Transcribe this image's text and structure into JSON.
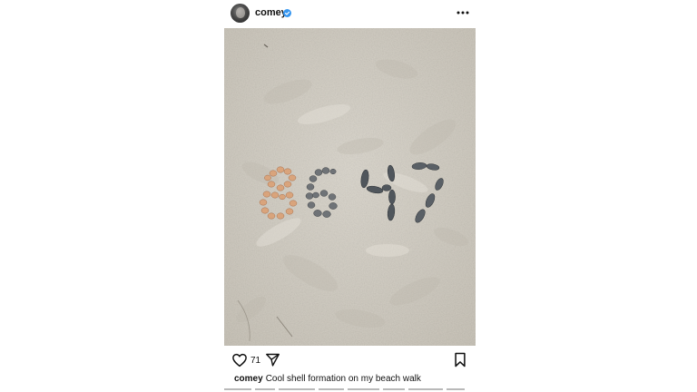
{
  "post": {
    "username": "comey",
    "verified": true,
    "likes": "71",
    "caption_user": "comey",
    "caption_text": "Cool shell formation on my beach walk"
  },
  "icons": {
    "verified": "verified-badge-icon",
    "more": "more-options-icon",
    "like": "heart-icon",
    "share": "send-icon",
    "save": "bookmark-icon"
  },
  "colors": {
    "verified_blue": "#3897f0",
    "sand": "#d6d2c9",
    "text": "#111111"
  }
}
